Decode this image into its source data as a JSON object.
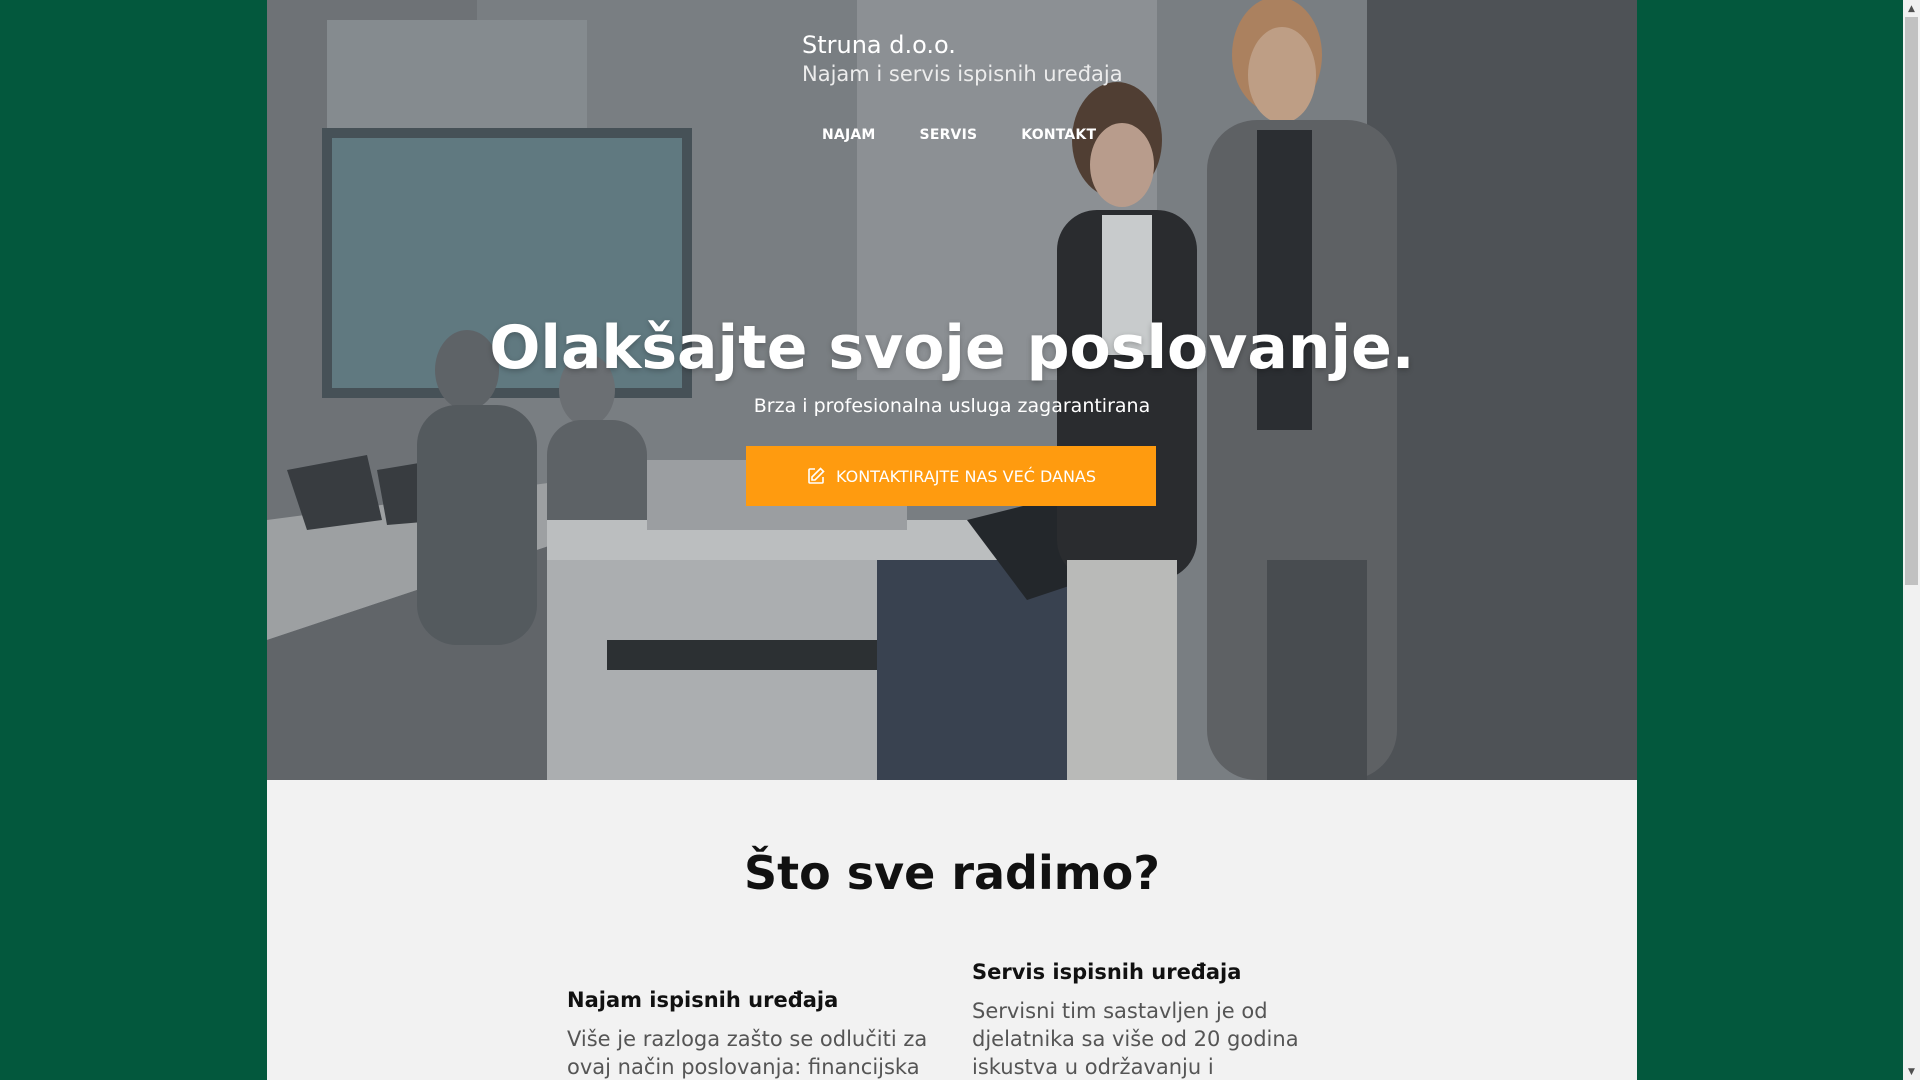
{
  "site": {
    "name": "Struna d.o.o.",
    "tagline": "Najam i servis ispisnih uređaja"
  },
  "nav": {
    "items": [
      {
        "label": "NAJAM"
      },
      {
        "label": "SERVIS"
      },
      {
        "label": "KONTAKT"
      }
    ]
  },
  "hero": {
    "title": "Olakšajte svoje poslovanje.",
    "subtitle": "Brza i profesionalna usluga zagarantirana",
    "cta_label": "KONTAKTIRAJTE NAS VEĆ DANAS",
    "cta_icon": "edit-icon",
    "cta_color": "#ff9b0f"
  },
  "services": {
    "title": "Što sve radimo?",
    "items": [
      {
        "title": "Najam ispisnih uređaja",
        "text": "Više je razloga zašto se odlučiti za ovaj način poslovanja: financijska"
      },
      {
        "title": "Servis ispisnih uređaja",
        "text": "Servisni tim sastavljen je od djelatnika sa više od 20 godina iskustva u održavanju i popravcima"
      }
    ]
  },
  "colors": {
    "outer_background": "#03583d",
    "page_background": "#f2f2f2"
  }
}
